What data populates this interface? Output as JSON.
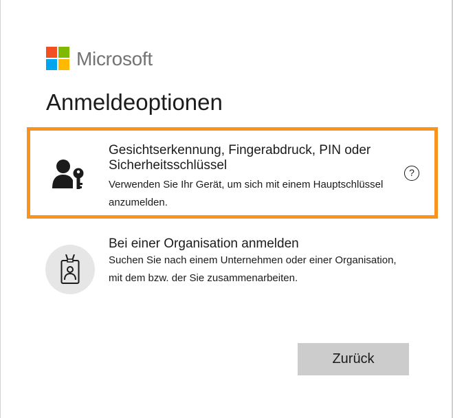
{
  "brand": {
    "name": "Microsoft",
    "logo_colors": [
      "#f25022",
      "#7fba00",
      "#00a4ef",
      "#ffb900"
    ]
  },
  "title": "Anmeldeoptionen",
  "options": [
    {
      "icon": "person-key-icon",
      "heading": "Gesichtserkennung, Fingerabdruck, PIN oder Sicherheitsschlüssel",
      "description": "Verwenden Sie Ihr Gerät, um sich mit einem Hauptschlüssel anzumelden.",
      "help_glyph": "?",
      "highlighted": true,
      "highlight_color": "#f7931e"
    },
    {
      "icon": "id-badge-icon",
      "heading": "Bei einer Organisation anmelden",
      "description": "Suchen Sie nach einem Unternehmen oder einer Organisation, mit dem bzw. der Sie zusammenarbeiten.",
      "highlighted": false
    }
  ],
  "back_button": {
    "label": "Zurück"
  }
}
